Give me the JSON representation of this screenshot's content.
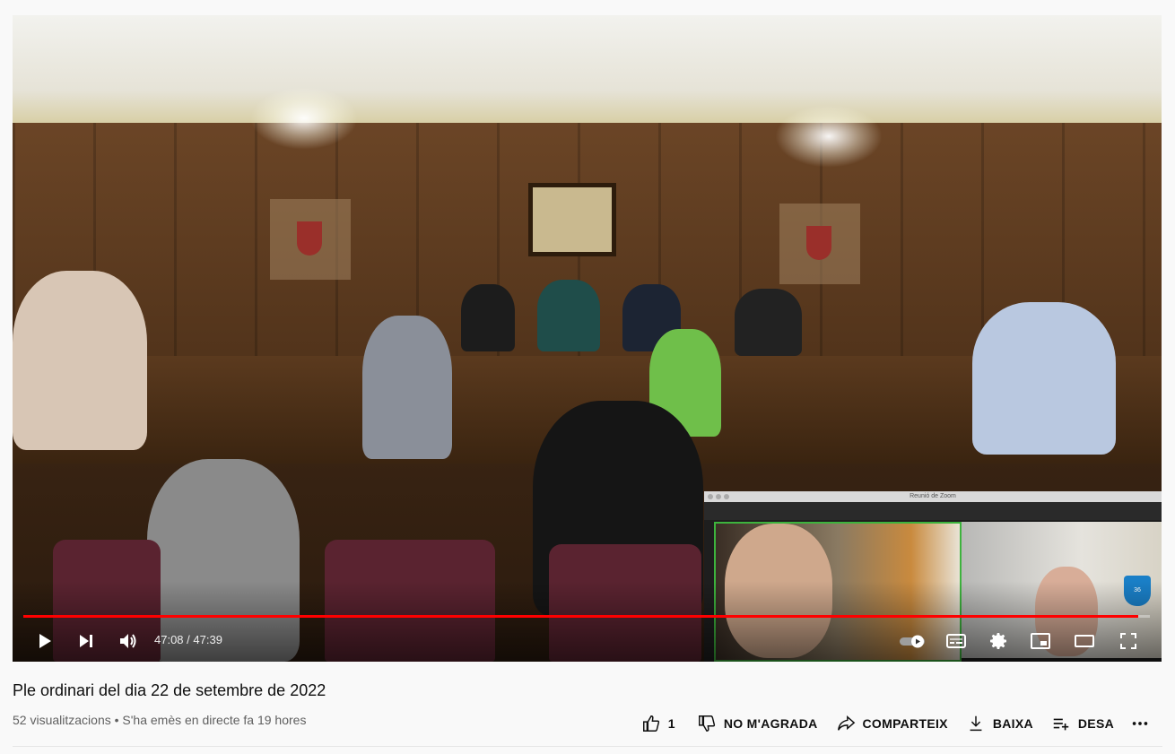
{
  "player": {
    "current_time": "47:08",
    "duration": "47:39",
    "time_separator": " / ",
    "progress": 0.99,
    "zoom_window_title": "Reunió de Zoom",
    "zoom_logo_text": "36"
  },
  "video": {
    "title": "Ple ordinari del dia 22 de setembre de 2022",
    "views": "52 visualitzacions",
    "separator": " • ",
    "streamed": "S'ha emès en directe fa 19 hores"
  },
  "actions": {
    "like_count": "1",
    "dislike_label": "NO M'AGRADA",
    "share_label": "COMPARTEIX",
    "download_label": "BAIXA",
    "save_label": "DESA"
  },
  "colors": {
    "progress": "#ff0000",
    "zoom_active_border": "#3db33d"
  },
  "icons": [
    "play-icon",
    "next-icon",
    "volume-icon",
    "autoplay-toggle-icon",
    "subtitles-icon",
    "settings-icon",
    "miniplayer-icon",
    "theater-icon",
    "fullscreen-icon",
    "thumbs-up-icon",
    "thumbs-down-icon",
    "share-icon",
    "download-icon",
    "save-playlist-icon",
    "more-icon"
  ]
}
